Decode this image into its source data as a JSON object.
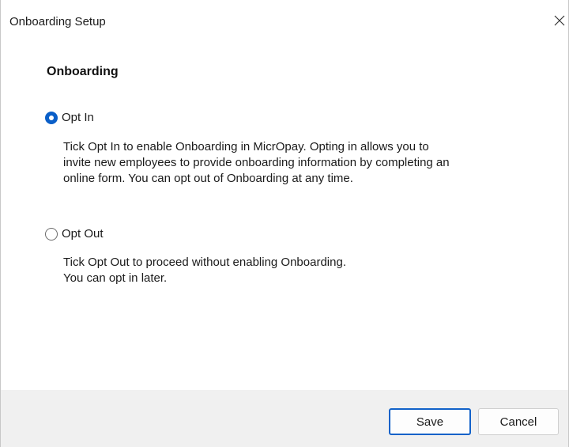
{
  "window": {
    "title": "Onboarding Setup",
    "close_icon": "close-icon"
  },
  "content": {
    "heading": "Onboarding",
    "options": [
      {
        "label": "Opt In",
        "selected": true,
        "description": [
          "Tick Opt In to enable Onboarding in MicrOpay. Opting in allows you to",
          "invite new employees to provide onboarding information by completing an",
          "online form. You can opt out of Onboarding at any time."
        ]
      },
      {
        "label": "Opt Out",
        "selected": false,
        "description": [
          "Tick Opt Out to proceed without enabling Onboarding.",
          "You can opt in later."
        ]
      }
    ]
  },
  "footer": {
    "save_label": "Save",
    "cancel_label": "Cancel"
  },
  "colors": {
    "accent": "#0a5fc8",
    "footer_bg": "#f0f0f0"
  }
}
